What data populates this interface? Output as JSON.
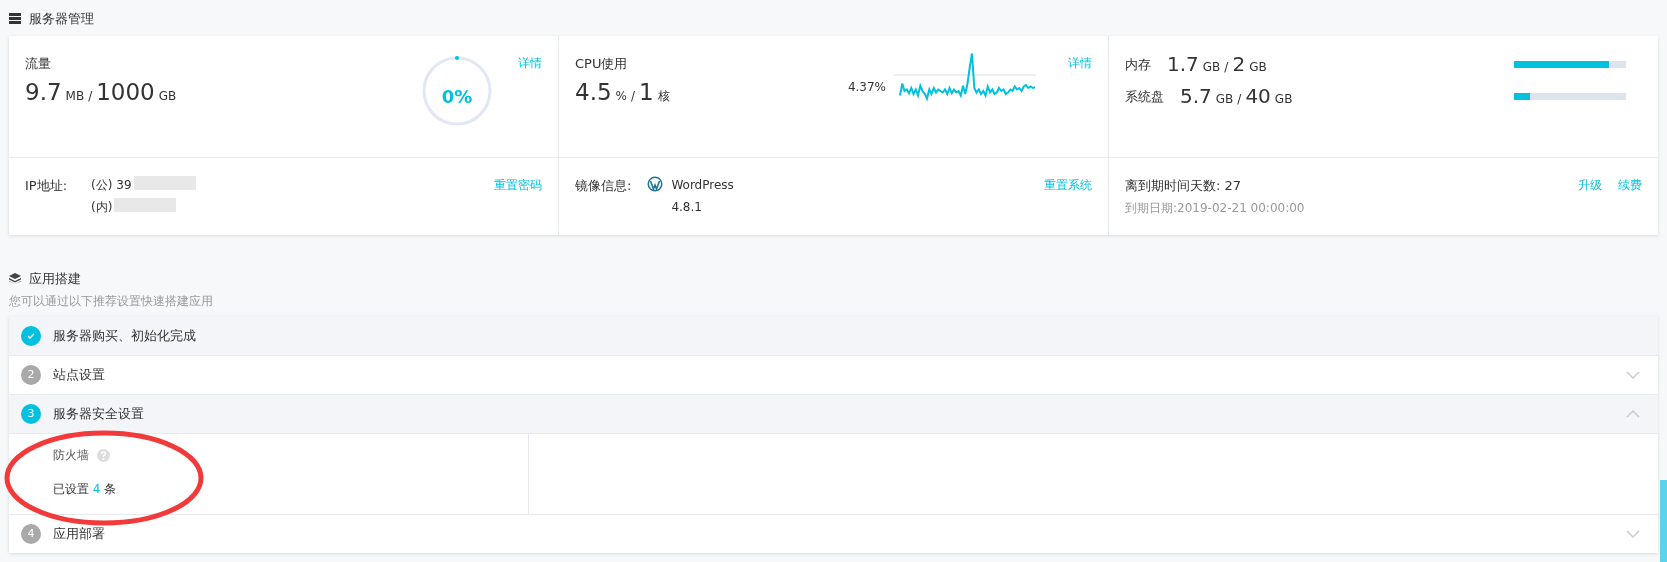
{
  "server_section": {
    "title": "服务器管理",
    "traffic": {
      "label": "流量",
      "used": "9.7",
      "used_unit": "MB",
      "sep": "/",
      "total": "1000",
      "total_unit": "GB",
      "ring_text": "0%",
      "link": "详情"
    },
    "cpu": {
      "label": "CPU使用",
      "used": "4.5",
      "used_unit": "%",
      "sep": "/",
      "total": "1",
      "total_unit": "核",
      "chart_label": "4.37%",
      "link": "详情"
    },
    "resources": [
      {
        "label": "内存",
        "used": "1.7",
        "used_unit": "GB",
        "sep": "/",
        "total": "2",
        "total_unit": "GB",
        "level": 0.85
      },
      {
        "label": "系统盘",
        "used": "5.7",
        "used_unit": "GB",
        "sep": "/",
        "total": "40",
        "total_unit": "GB",
        "level": 0.14
      }
    ],
    "ip": {
      "label": "IP地址:",
      "public": "(公) 39",
      "private": "(内)",
      "link": "重置密码"
    },
    "image": {
      "label": "镜像信息:",
      "name": "WordPress",
      "version": "4.8.1",
      "link": "重置系统"
    },
    "expiry": {
      "days_label": "离到期时间天数:",
      "days": "27",
      "date": "到期日期:2019-02-21 00:00:00",
      "links": [
        "升级",
        "续费"
      ]
    }
  },
  "app_section": {
    "title": "应用搭建",
    "subtitle": "您可以通过以下推荐设置快速搭建应用",
    "steps": [
      {
        "label": "服务器购买、初始化完成",
        "kind": "done",
        "expanded": false
      },
      {
        "number": "2",
        "label": "站点设置",
        "kind": "todo",
        "expanded": false
      },
      {
        "number": "3",
        "label": "服务器安全设置",
        "kind": "current",
        "expanded": true,
        "panel": {
          "title": "防火墙",
          "before": "已设置",
          "count": "4",
          "after": "条"
        }
      },
      {
        "number": "4",
        "label": "应用部署",
        "kind": "todo",
        "expanded": false
      }
    ]
  },
  "annotation": {
    "kind": "ellipse",
    "color": "#f23a3a"
  }
}
